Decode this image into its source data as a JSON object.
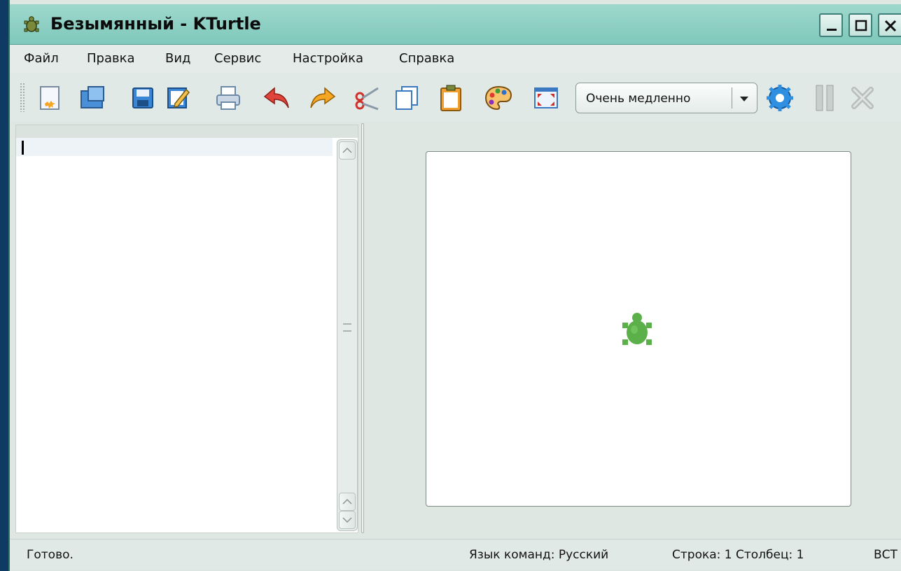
{
  "window": {
    "title": "Безымянный - KTurtle",
    "controls": [
      "minimize",
      "maximize",
      "close"
    ]
  },
  "menu": {
    "items": [
      {
        "label": "Файл"
      },
      {
        "label": "Правка"
      },
      {
        "label": "Вид"
      },
      {
        "label": "Сервис"
      },
      {
        "label": "Настройка"
      },
      {
        "label": "Справка"
      }
    ]
  },
  "toolbar": {
    "tools": [
      "new-file",
      "open-file",
      "save-file",
      "save-as",
      "print",
      "undo",
      "redo",
      "cut",
      "copy",
      "paste",
      "color-picker",
      "fullscreen"
    ],
    "speed": {
      "value": "Очень медленно"
    },
    "actions": [
      "run",
      "pause",
      "abort"
    ]
  },
  "editor": {
    "content": ""
  },
  "canvas": {
    "background": "#ffffff",
    "turtle_color": "#5bb04a"
  },
  "status": {
    "ready": "Готово.",
    "language": "Язык команд: Русский",
    "position": "Строка: 1 Столбец: 1",
    "mode": "ВСТ"
  }
}
